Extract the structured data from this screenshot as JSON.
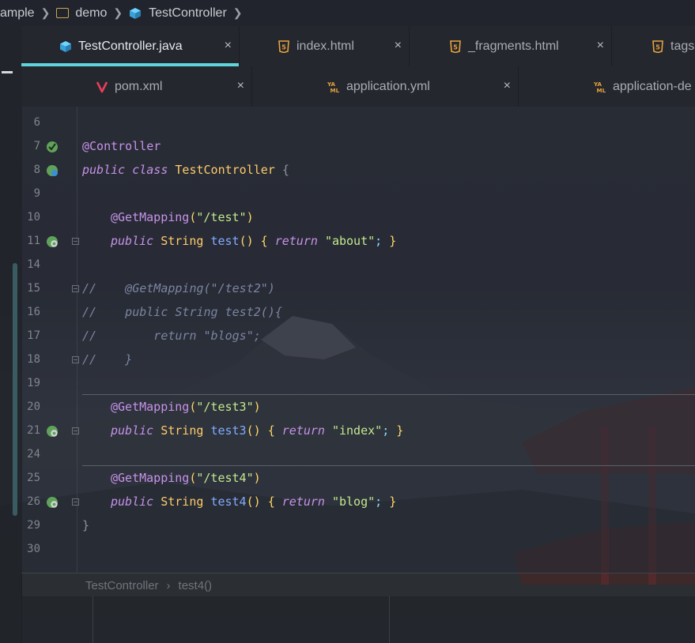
{
  "breadcrumb": {
    "items": [
      "ample",
      "demo",
      "TestController"
    ]
  },
  "tabs_row1": [
    {
      "label": "TestController.java",
      "icon": "java-class-icon",
      "active": true
    },
    {
      "label": "index.html",
      "icon": "html5-icon",
      "active": false
    },
    {
      "label": "_fragments.html",
      "icon": "html5-icon",
      "active": false
    },
    {
      "label": "tags",
      "icon": "html5-icon",
      "active": false
    }
  ],
  "tabs_row2": [
    {
      "label": "pom.xml",
      "icon": "maven-icon"
    },
    {
      "label": "application.yml",
      "icon": "yaml-icon"
    },
    {
      "label": "application-de",
      "icon": "yaml-icon"
    }
  ],
  "close_glyph": "×",
  "code_lines": [
    {
      "num": "6"
    },
    {
      "num": "7"
    },
    {
      "num": "8"
    },
    {
      "num": "9"
    },
    {
      "num": "10"
    },
    {
      "num": "11"
    },
    {
      "num": "14"
    },
    {
      "num": "15"
    },
    {
      "num": "16"
    },
    {
      "num": "17"
    },
    {
      "num": "18"
    },
    {
      "num": "19"
    },
    {
      "num": "20"
    },
    {
      "num": "21"
    },
    {
      "num": "24"
    },
    {
      "num": "25"
    },
    {
      "num": "26"
    },
    {
      "num": "29"
    },
    {
      "num": "30"
    }
  ],
  "code": {
    "l7": "@Controller",
    "l8_kw1": "public",
    "l8_kw2": "class",
    "l8_name": "TestController",
    "l8_brace": "{",
    "l10_ann": "@GetMapping",
    "l10_paren_open": "(",
    "l10_str": "\"/test\"",
    "l10_paren_close": ")",
    "l11_kw": "public",
    "l11_type": "String",
    "l11_fn": "test",
    "l11_rest1": "() ",
    "l11_brace": "{",
    "l11_ret": "return",
    "l11_str": "\"about\"",
    "l11_semi": ";",
    "l11_close": "}",
    "l15": "//    @GetMapping(\"/test2\")",
    "l16": "//    public String test2(){",
    "l17": "//        return \"blogs\";",
    "l18": "//    }",
    "l20_ann": "@GetMapping",
    "l20_str": "\"/test3\"",
    "l21_fn": "test3",
    "l21_str": "\"index\"",
    "l25_ann": "@GetMapping",
    "l25_str": "\"/test4\"",
    "l26_fn": "test4",
    "l26_str": "\"blog\"",
    "l29": "}"
  },
  "bottom_breadcrumb": {
    "items": [
      "TestController",
      "test4()"
    ],
    "sep": "›"
  },
  "colors": {
    "accent": "#5fd4dc",
    "keyword": "#c792ea",
    "type": "#ffcb6b",
    "function": "#82aaff",
    "string": "#c3e88d",
    "comment": "#7b84a3"
  }
}
